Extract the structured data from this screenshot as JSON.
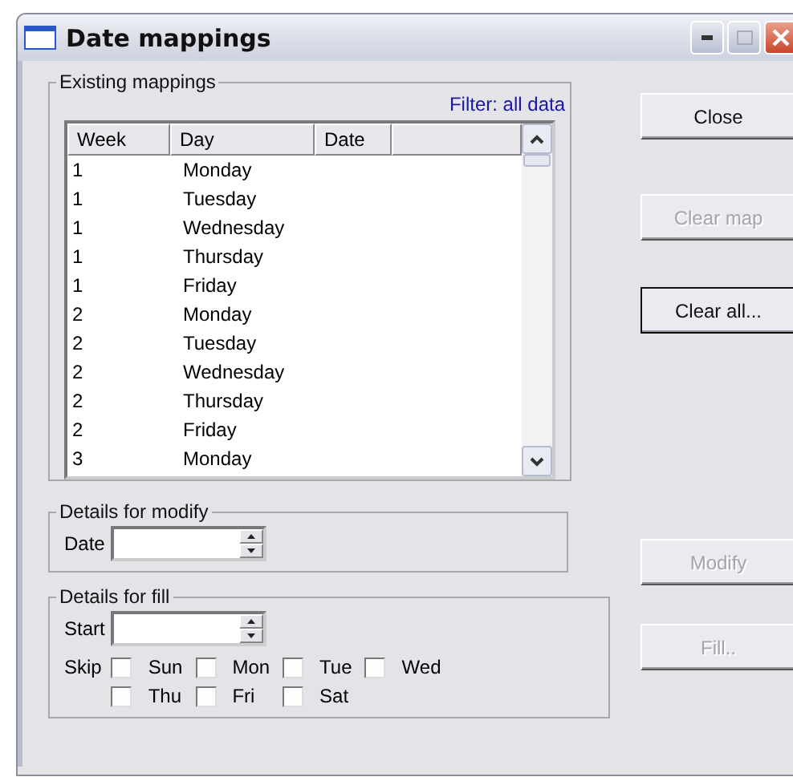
{
  "window": {
    "title": "Date mappings"
  },
  "existing_mappings": {
    "label": "Existing mappings",
    "filter": "Filter: all data",
    "columns": [
      "Week",
      "Day",
      "Date"
    ],
    "rows": [
      {
        "week": "1",
        "day": "Monday"
      },
      {
        "week": "1",
        "day": "Tuesday"
      },
      {
        "week": "1",
        "day": "Wednesday"
      },
      {
        "week": "1",
        "day": "Thursday"
      },
      {
        "week": "1",
        "day": "Friday"
      },
      {
        "week": "2",
        "day": "Monday"
      },
      {
        "week": "2",
        "day": "Tuesday"
      },
      {
        "week": "2",
        "day": "Wednesday"
      },
      {
        "week": "2",
        "day": "Thursday"
      },
      {
        "week": "2",
        "day": "Friday"
      },
      {
        "week": "3",
        "day": "Monday"
      }
    ]
  },
  "details_for_modify": {
    "label": "Details for modify",
    "date_label": "Date"
  },
  "details_for_fill": {
    "label": "Details for fill",
    "start_label": "Start",
    "skip_label": "Skip",
    "days": [
      {
        "label": "Sun",
        "checked": false
      },
      {
        "label": "Mon",
        "checked": false
      },
      {
        "label": "Tue",
        "checked": false
      },
      {
        "label": "Wed",
        "checked": false
      },
      {
        "label": "Thu",
        "checked": false
      },
      {
        "label": "Fri",
        "checked": false
      },
      {
        "label": "Sat",
        "checked": false
      }
    ]
  },
  "buttons": [
    {
      "label": "Close",
      "disabled": false,
      "default": false
    },
    {
      "label": "Clear map",
      "disabled": true,
      "default": false
    },
    {
      "label": "Clear all...",
      "disabled": false,
      "default": true
    },
    {
      "label": "Modify",
      "disabled": true,
      "default": false
    },
    {
      "label": "Fill..",
      "disabled": true,
      "default": false
    }
  ]
}
